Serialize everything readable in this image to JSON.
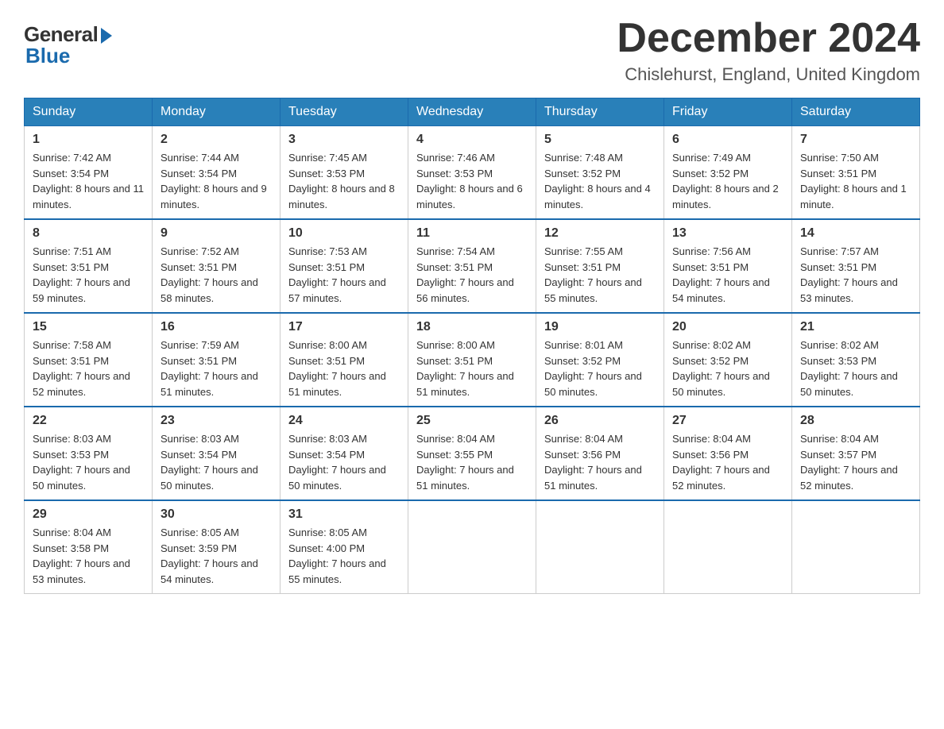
{
  "logo": {
    "general": "General",
    "blue": "Blue"
  },
  "header": {
    "month_year": "December 2024",
    "location": "Chislehurst, England, United Kingdom"
  },
  "days_of_week": [
    "Sunday",
    "Monday",
    "Tuesday",
    "Wednesday",
    "Thursday",
    "Friday",
    "Saturday"
  ],
  "weeks": [
    [
      {
        "day": "1",
        "sunrise": "7:42 AM",
        "sunset": "3:54 PM",
        "daylight": "8 hours and 11 minutes."
      },
      {
        "day": "2",
        "sunrise": "7:44 AM",
        "sunset": "3:54 PM",
        "daylight": "8 hours and 9 minutes."
      },
      {
        "day": "3",
        "sunrise": "7:45 AM",
        "sunset": "3:53 PM",
        "daylight": "8 hours and 8 minutes."
      },
      {
        "day": "4",
        "sunrise": "7:46 AM",
        "sunset": "3:53 PM",
        "daylight": "8 hours and 6 minutes."
      },
      {
        "day": "5",
        "sunrise": "7:48 AM",
        "sunset": "3:52 PM",
        "daylight": "8 hours and 4 minutes."
      },
      {
        "day": "6",
        "sunrise": "7:49 AM",
        "sunset": "3:52 PM",
        "daylight": "8 hours and 2 minutes."
      },
      {
        "day": "7",
        "sunrise": "7:50 AM",
        "sunset": "3:51 PM",
        "daylight": "8 hours and 1 minute."
      }
    ],
    [
      {
        "day": "8",
        "sunrise": "7:51 AM",
        "sunset": "3:51 PM",
        "daylight": "7 hours and 59 minutes."
      },
      {
        "day": "9",
        "sunrise": "7:52 AM",
        "sunset": "3:51 PM",
        "daylight": "7 hours and 58 minutes."
      },
      {
        "day": "10",
        "sunrise": "7:53 AM",
        "sunset": "3:51 PM",
        "daylight": "7 hours and 57 minutes."
      },
      {
        "day": "11",
        "sunrise": "7:54 AM",
        "sunset": "3:51 PM",
        "daylight": "7 hours and 56 minutes."
      },
      {
        "day": "12",
        "sunrise": "7:55 AM",
        "sunset": "3:51 PM",
        "daylight": "7 hours and 55 minutes."
      },
      {
        "day": "13",
        "sunrise": "7:56 AM",
        "sunset": "3:51 PM",
        "daylight": "7 hours and 54 minutes."
      },
      {
        "day": "14",
        "sunrise": "7:57 AM",
        "sunset": "3:51 PM",
        "daylight": "7 hours and 53 minutes."
      }
    ],
    [
      {
        "day": "15",
        "sunrise": "7:58 AM",
        "sunset": "3:51 PM",
        "daylight": "7 hours and 52 minutes."
      },
      {
        "day": "16",
        "sunrise": "7:59 AM",
        "sunset": "3:51 PM",
        "daylight": "7 hours and 51 minutes."
      },
      {
        "day": "17",
        "sunrise": "8:00 AM",
        "sunset": "3:51 PM",
        "daylight": "7 hours and 51 minutes."
      },
      {
        "day": "18",
        "sunrise": "8:00 AM",
        "sunset": "3:51 PM",
        "daylight": "7 hours and 51 minutes."
      },
      {
        "day": "19",
        "sunrise": "8:01 AM",
        "sunset": "3:52 PM",
        "daylight": "7 hours and 50 minutes."
      },
      {
        "day": "20",
        "sunrise": "8:02 AM",
        "sunset": "3:52 PM",
        "daylight": "7 hours and 50 minutes."
      },
      {
        "day": "21",
        "sunrise": "8:02 AM",
        "sunset": "3:53 PM",
        "daylight": "7 hours and 50 minutes."
      }
    ],
    [
      {
        "day": "22",
        "sunrise": "8:03 AM",
        "sunset": "3:53 PM",
        "daylight": "7 hours and 50 minutes."
      },
      {
        "day": "23",
        "sunrise": "8:03 AM",
        "sunset": "3:54 PM",
        "daylight": "7 hours and 50 minutes."
      },
      {
        "day": "24",
        "sunrise": "8:03 AM",
        "sunset": "3:54 PM",
        "daylight": "7 hours and 50 minutes."
      },
      {
        "day": "25",
        "sunrise": "8:04 AM",
        "sunset": "3:55 PM",
        "daylight": "7 hours and 51 minutes."
      },
      {
        "day": "26",
        "sunrise": "8:04 AM",
        "sunset": "3:56 PM",
        "daylight": "7 hours and 51 minutes."
      },
      {
        "day": "27",
        "sunrise": "8:04 AM",
        "sunset": "3:56 PM",
        "daylight": "7 hours and 52 minutes."
      },
      {
        "day": "28",
        "sunrise": "8:04 AM",
        "sunset": "3:57 PM",
        "daylight": "7 hours and 52 minutes."
      }
    ],
    [
      {
        "day": "29",
        "sunrise": "8:04 AM",
        "sunset": "3:58 PM",
        "daylight": "7 hours and 53 minutes."
      },
      {
        "day": "30",
        "sunrise": "8:05 AM",
        "sunset": "3:59 PM",
        "daylight": "7 hours and 54 minutes."
      },
      {
        "day": "31",
        "sunrise": "8:05 AM",
        "sunset": "4:00 PM",
        "daylight": "7 hours and 55 minutes."
      },
      null,
      null,
      null,
      null
    ]
  ]
}
